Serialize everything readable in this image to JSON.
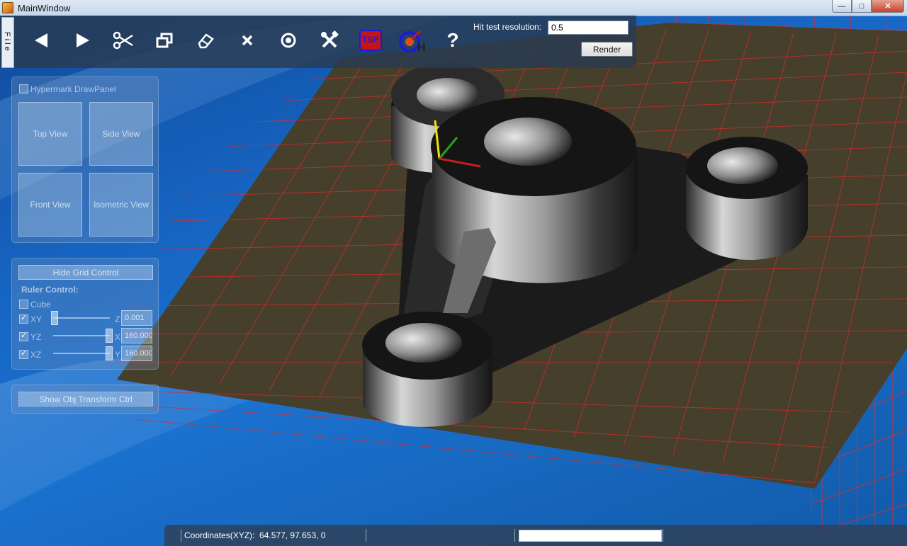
{
  "window": {
    "title": "MainWindow",
    "min": "—",
    "max": "□",
    "close": "✕"
  },
  "file_menu": "File",
  "toolbar": {
    "icons": [
      "back-icon",
      "forward-icon",
      "scissors-icon",
      "windows-icon",
      "eraser-icon",
      "close-icon",
      "target-icon",
      "tools-icon",
      "tsp-icon",
      "hit-icon",
      "help-icon"
    ],
    "tsp_label": "TSP",
    "help_label": "?",
    "hit_test_label": "Hit test resolution:",
    "hit_test_value": "0.5",
    "render_label": "Render"
  },
  "draw_panel": {
    "title": "Hypermark DrawPanel",
    "views": [
      "Top View",
      "Side View",
      "Front View",
      "Isometric View"
    ]
  },
  "grid_panel": {
    "hide_button": "Hide Grid Control",
    "ruler_label": "Ruler Control:",
    "cube_label": "Cube",
    "rows": [
      {
        "label": "XY",
        "axis": "Z",
        "value": "0.001"
      },
      {
        "label": "YZ",
        "axis": "X",
        "value": "160.000"
      },
      {
        "label": "XZ",
        "axis": "Y",
        "value": "160.000"
      }
    ]
  },
  "transform_button": "Show Obj Transform Ctrl",
  "status": {
    "coords_label": "Coordinates(XYZ):",
    "coords_value": "64.577, 97.653, 0"
  },
  "colors": {
    "desktop": "#1766c4",
    "plate": "#463f2c",
    "grid": "#e02a2a",
    "toolbar": "#283a50"
  }
}
